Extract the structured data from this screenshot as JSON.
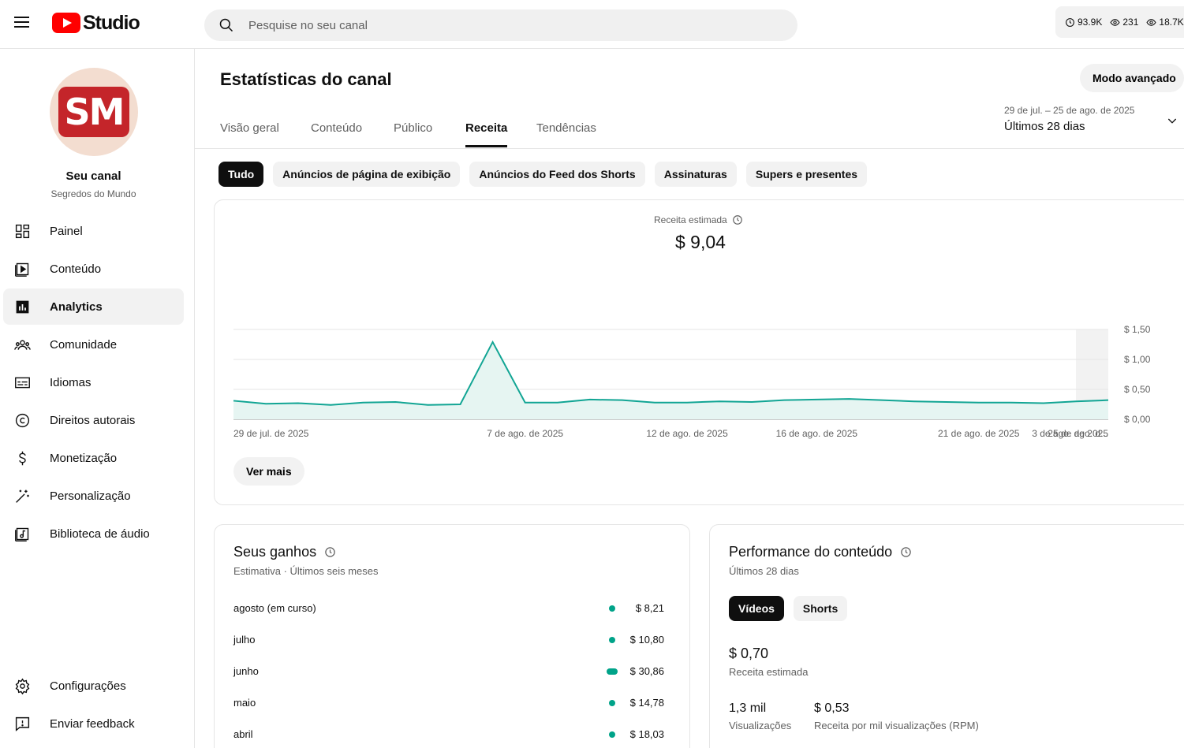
{
  "header": {
    "logo_text": "Studio",
    "search_placeholder": "Pesquise no seu canal",
    "stats": [
      "93.9K",
      "231",
      "18.7K"
    ]
  },
  "sidebar": {
    "avatar_initials": "SM",
    "channel_name": "Seu canal",
    "channel_sub": "Segredos do Mundo",
    "items": [
      {
        "label": "Painel",
        "icon": "dashboard-icon"
      },
      {
        "label": "Conteúdo",
        "icon": "content-icon"
      },
      {
        "label": "Analytics",
        "icon": "analytics-icon"
      },
      {
        "label": "Comunidade",
        "icon": "community-icon"
      },
      {
        "label": "Idiomas",
        "icon": "subtitles-icon"
      },
      {
        "label": "Direitos autorais",
        "icon": "copyright-icon"
      },
      {
        "label": "Monetização",
        "icon": "dollar-icon"
      },
      {
        "label": "Personalização",
        "icon": "magic-wand-icon"
      },
      {
        "label": "Biblioteca de áudio",
        "icon": "audio-library-icon"
      }
    ],
    "bottom_items": [
      {
        "label": "Configurações",
        "icon": "gear-icon"
      },
      {
        "label": "Enviar feedback",
        "icon": "feedback-icon"
      }
    ]
  },
  "main": {
    "title": "Estatísticas do canal",
    "advanced_button": "Modo avançado",
    "tabs": [
      "Visão geral",
      "Conteúdo",
      "Público",
      "Receita",
      "Tendências"
    ],
    "active_tab": "Receita",
    "date_range": {
      "dates": "29 de jul. – 25 de ago. de 2025",
      "label": "Últimos 28 dias"
    },
    "chips": [
      "Tudo",
      "Anúncios de página de exibição",
      "Anúncios do Feed dos Shorts",
      "Assinaturas",
      "Supers e presentes"
    ],
    "metric_label": "Receita estimada",
    "metric_value": "$ 9,04",
    "see_more": "Ver mais"
  },
  "chart_data": {
    "type": "area",
    "x": [
      "29 de jul. de 2025",
      "30 de jul.",
      "31 de jul.",
      "1 de ago.",
      "2 de ago.",
      "3 de ago.",
      "4 de ago.",
      "5 de ago.",
      "6 de ago.",
      "7 de ago. de 2025",
      "8 de ago.",
      "9 de ago.",
      "10 de ago.",
      "11 de ago.",
      "12 de ago. de 2025",
      "13 de ago.",
      "14 de ago.",
      "15 de ago.",
      "16 de ago. de 2025",
      "17 de ago.",
      "18 de ago.",
      "19 de ago.",
      "20 de ago.",
      "21 de ago. de 2025",
      "22 de ago.",
      "23 de ago.",
      "24 de ago.",
      "25 de ago."
    ],
    "values": [
      0.31,
      0.26,
      0.27,
      0.24,
      0.28,
      0.29,
      0.24,
      0.25,
      1.29,
      0.28,
      0.28,
      0.33,
      0.32,
      0.28,
      0.28,
      0.3,
      0.29,
      0.32,
      0.33,
      0.34,
      0.32,
      0.3,
      0.29,
      0.28,
      0.28,
      0.27,
      0.3,
      0.32
    ],
    "x_tick_labels": [
      "29 de jul. de 2025",
      "3 de ago. de 2025",
      "7 de ago. de 2025",
      "12 de ago. de 2025",
      "16 de ago. de 2025",
      "21 de ago. de 2025",
      "25 de ago. d..."
    ],
    "y_ticks": [
      "$ 0,00",
      "$ 0,50",
      "$ 1,00",
      "$ 1,50"
    ],
    "ylim": [
      0,
      1.5
    ],
    "line_color": "#12a594",
    "fill_color": "#e6f5f2"
  },
  "earnings": {
    "title": "Seus ganhos",
    "subtitle": "Estimativa · Últimos seis meses",
    "rows": [
      {
        "month": "agosto (em curso)",
        "amount": "$ 8,21",
        "value": 8.21
      },
      {
        "month": "julho",
        "amount": "$ 10,80",
        "value": 10.8
      },
      {
        "month": "junho",
        "amount": "$ 30,86",
        "value": 30.86
      },
      {
        "month": "maio",
        "amount": "$ 14,78",
        "value": 14.78
      },
      {
        "month": "abril",
        "amount": "$ 18,03",
        "value": 18.03
      }
    ]
  },
  "performance": {
    "title": "Performance do conteúdo",
    "subtitle": "Últimos 28 dias",
    "segments": [
      "Vídeos",
      "Shorts"
    ],
    "revenue_value": "$ 0,70",
    "revenue_label": "Receita estimada",
    "views_value": "1,3 mil",
    "views_label": "Visualizações",
    "rpm_value": "$ 0,53",
    "rpm_label": "Receita por mil visualizações (RPM)"
  }
}
